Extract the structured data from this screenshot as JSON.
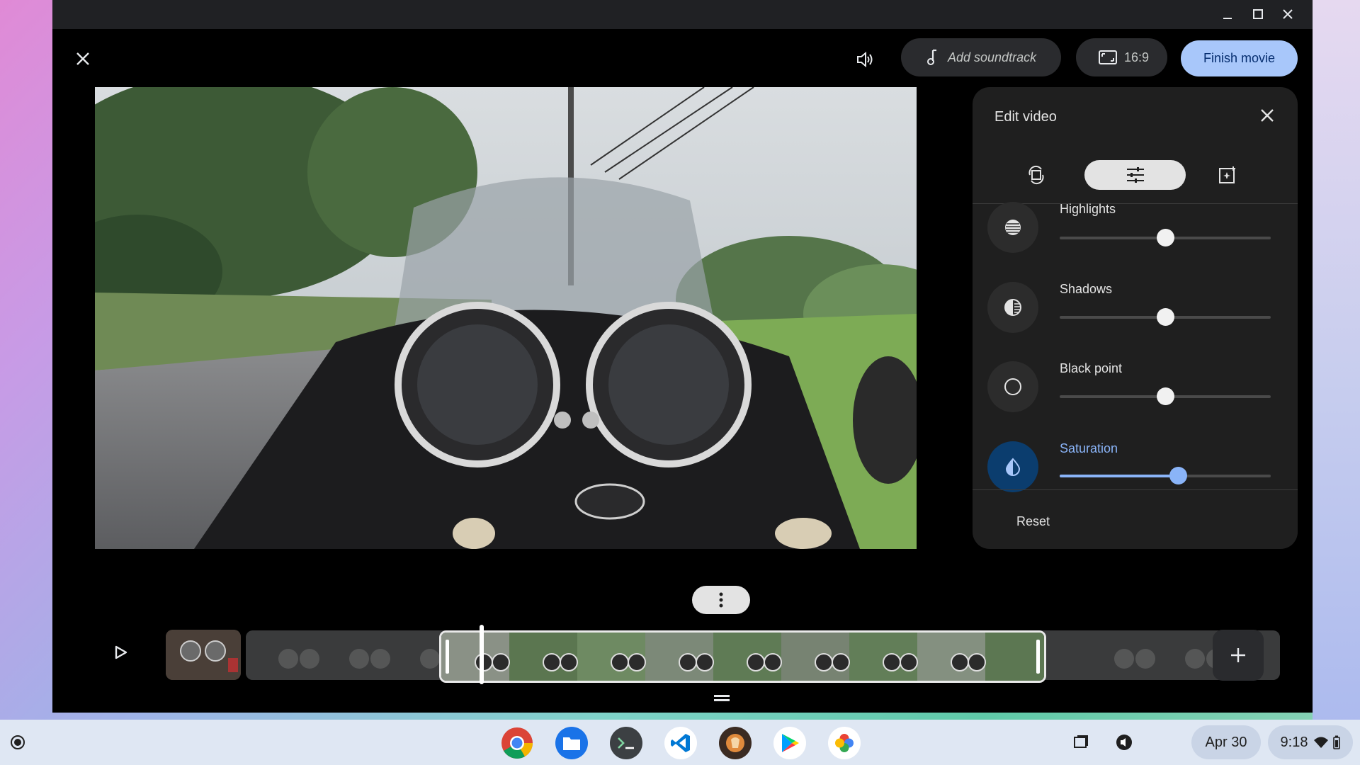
{
  "toolbar": {
    "soundtrack_label": "Add soundtrack",
    "aspect_label": "16:9",
    "finish_label": "Finish movie"
  },
  "edit_panel": {
    "title": "Edit video",
    "tabs": [
      {
        "icon": "rotate-crop-icon",
        "active": false
      },
      {
        "icon": "adjust-sliders-icon",
        "active": true
      },
      {
        "icon": "add-filter-icon",
        "active": false
      }
    ],
    "adjustments": [
      {
        "label": "Highlights",
        "icon": "highlights-icon",
        "value": 0.5,
        "active": false
      },
      {
        "label": "Shadows",
        "icon": "shadows-icon",
        "value": 0.5,
        "active": false
      },
      {
        "label": "Black point",
        "icon": "black-point-icon",
        "value": 0.5,
        "active": false
      },
      {
        "label": "Saturation",
        "icon": "saturation-icon",
        "value": 0.56,
        "active": true
      }
    ],
    "reset_label": "Reset"
  },
  "timeline": {
    "selection_start": 0.18,
    "selection_end": 0.77,
    "playhead": 0.22
  },
  "shelf": {
    "apps": [
      "chrome-icon",
      "files-icon",
      "terminal-icon",
      "vscode-icon",
      "app-icon",
      "play-store-icon",
      "photos-icon"
    ],
    "date": "Apr 30",
    "time": "9:18"
  },
  "colors": {
    "accent": "#a8c7fa",
    "slider_active": "#8ab4f8",
    "panel_bg": "#1f1f1f"
  }
}
